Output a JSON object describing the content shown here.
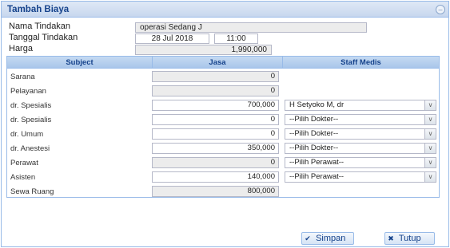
{
  "dialog": {
    "title": "Tambah Biaya",
    "tool_icon": "collapse-icon"
  },
  "form": {
    "nama_tindakan_label": "Nama Tindakan",
    "nama_tindakan_value": "operasi Sedang J",
    "tanggal_tindakan_label": "Tanggal Tindakan",
    "tanggal_value": "28 Jul 2018",
    "jam_value": "11:00",
    "harga_label": "Harga",
    "harga_value": "1,990,000"
  },
  "grid": {
    "columns": [
      "Subject",
      "Jasa",
      "Staff Medis"
    ],
    "rows": [
      {
        "subject": "Sarana",
        "jasa": "0",
        "editable": false,
        "staff": null
      },
      {
        "subject": "Pelayanan",
        "jasa": "0",
        "editable": false,
        "staff": null
      },
      {
        "subject": "dr. Spesialis",
        "jasa": "700,000",
        "editable": true,
        "staff": "H Setyoko M, dr"
      },
      {
        "subject": "dr. Spesialis",
        "jasa": "0",
        "editable": true,
        "staff": "--Pilih Dokter--"
      },
      {
        "subject": "dr. Umum",
        "jasa": "0",
        "editable": true,
        "staff": "--Pilih Dokter--"
      },
      {
        "subject": "dr. Anestesi",
        "jasa": "350,000",
        "editable": true,
        "staff": "--Pilih Dokter--"
      },
      {
        "subject": "Perawat",
        "jasa": "0",
        "editable": false,
        "staff": "--Pilih Perawat--"
      },
      {
        "subject": "Asisten",
        "jasa": "140,000",
        "editable": true,
        "staff": "--Pilih Perawat--"
      },
      {
        "subject": "Sewa Ruang",
        "jasa": "800,000",
        "editable": false,
        "staff": null
      }
    ]
  },
  "buttons": {
    "simpan_label": "Simpan",
    "tutup_label": "Tutup"
  }
}
